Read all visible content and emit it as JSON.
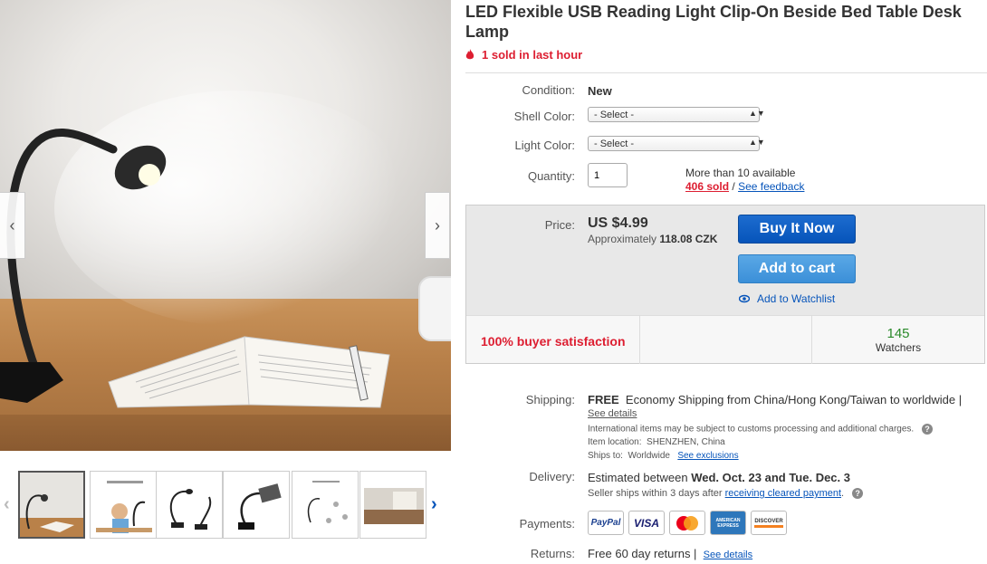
{
  "title": "LED Flexible USB Reading Light Clip-On Beside Bed Table Desk Lamp",
  "hot_text": "1 sold in last hour",
  "condition": {
    "label": "Condition:",
    "value": "New"
  },
  "shell_color": {
    "label": "Shell Color:",
    "selected": "- Select -"
  },
  "light_color": {
    "label": "Light Color:",
    "selected": "- Select -"
  },
  "quantity": {
    "label": "Quantity:",
    "value": "1",
    "available": "More than 10 available",
    "sold": "406 sold",
    "separator": "/",
    "feedback": "See feedback"
  },
  "price": {
    "label": "Price:",
    "amount": "US $4.99",
    "approx_label": "Approximately",
    "approx_value": "118.08 CZK"
  },
  "buttons": {
    "buy_now": "Buy It Now",
    "add_to_cart": "Add to cart",
    "watchlist": "Add to Watchlist"
  },
  "stats": {
    "satisfaction": "100% buyer satisfaction",
    "watchers_count": "145",
    "watchers_label": "Watchers"
  },
  "shipping": {
    "label": "Shipping:",
    "free": "FREE",
    "method": "Economy Shipping from China/Hong Kong/Taiwan to worldwide |",
    "see_details": "See details",
    "customs_note": "International items may be subject to customs processing and additional charges.",
    "location_label": "Item location:",
    "location": "SHENZHEN, China",
    "ships_to_label": "Ships to:",
    "ships_to": "Worldwide",
    "exclusions": "See exclusions"
  },
  "delivery": {
    "label": "Delivery:",
    "estimated_prefix": "Estimated between",
    "dates": "Wed. Oct. 23 and Tue. Dec. 3",
    "ships_within": "Seller ships within 3 days after",
    "payment_link": "receiving cleared payment",
    "period": "."
  },
  "payments": {
    "label": "Payments:",
    "methods": [
      "PayPal",
      "VISA",
      "MasterCard",
      "AMERICAN EXPRESS",
      "DISCOVER"
    ]
  },
  "returns": {
    "label": "Returns:",
    "value": "Free 60 day returns |",
    "see_details": "See details"
  },
  "images": {
    "prev_icon": "chevron-left-icon",
    "next_icon": "chevron-right-icon"
  },
  "colors": {
    "accent": "#0654ba",
    "hot": "#dd1e31",
    "buy_button": "#0654ba",
    "cart_button": "#3b8fd8",
    "watchers": "#2a8a2a"
  }
}
